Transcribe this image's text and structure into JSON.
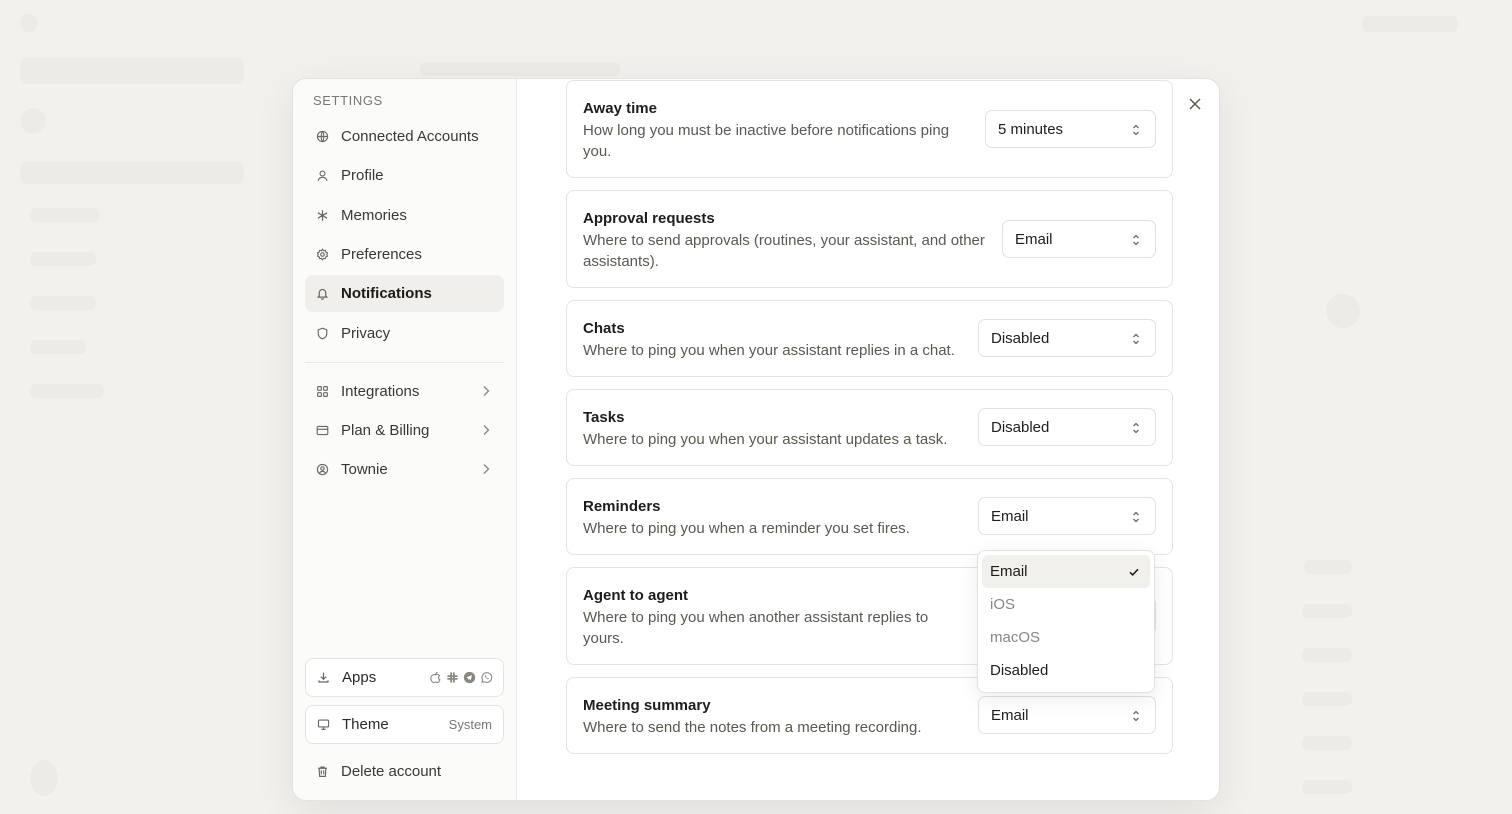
{
  "settings": {
    "title": "SETTINGS",
    "nav": [
      {
        "label": "Connected Accounts",
        "icon": "globe-icon"
      },
      {
        "label": "Profile",
        "icon": "user-icon"
      },
      {
        "label": "Memories",
        "icon": "asterisk-icon"
      },
      {
        "label": "Preferences",
        "icon": "gear-icon"
      },
      {
        "label": "Notifications",
        "icon": "bell-icon",
        "active": true
      },
      {
        "label": "Privacy",
        "icon": "shield-icon"
      }
    ],
    "nav_secondary": [
      {
        "label": "Integrations",
        "icon": "grid-icon"
      },
      {
        "label": "Plan & Billing",
        "icon": "credit-card-icon"
      },
      {
        "label": "Townie",
        "icon": "user-circle-icon"
      }
    ],
    "apps": {
      "label": "Apps",
      "icons": [
        "apple-icon",
        "slack-icon",
        "telegram-icon",
        "whatsapp-icon"
      ]
    },
    "theme": {
      "label": "Theme",
      "value": "System"
    },
    "delete_account": "Delete account"
  },
  "notifications": [
    {
      "title": "Away time",
      "desc_line1": "How long you must be inactive before notifications ping",
      "desc_line2": "you.",
      "value": "5 minutes"
    },
    {
      "title": "Approval requests",
      "desc_line1": "Where to send approvals (routines, your assistant, and other",
      "desc_line2": "assistants).",
      "value": "Email"
    },
    {
      "title": "Chats",
      "desc_line1": "Where to ping you when your assistant replies in a chat.",
      "value": "Disabled"
    },
    {
      "title": "Tasks",
      "desc_line1": "Where to ping you when your assistant updates a task.",
      "value": "Disabled"
    },
    {
      "title": "Reminders",
      "desc_line1": "Where to ping you when a reminder you set fires.",
      "value": "Email"
    },
    {
      "title": "Agent to agent",
      "desc_line1": "Where to ping you when another assistant replies to",
      "desc_line2": "yours.",
      "value": ""
    },
    {
      "title": "Meeting summary",
      "desc_line1": "Where to send the notes from a meeting recording.",
      "value": "Email"
    }
  ],
  "dropdown": {
    "options": [
      "Email",
      "iOS",
      "macOS",
      "Disabled"
    ],
    "selected": "Email"
  }
}
